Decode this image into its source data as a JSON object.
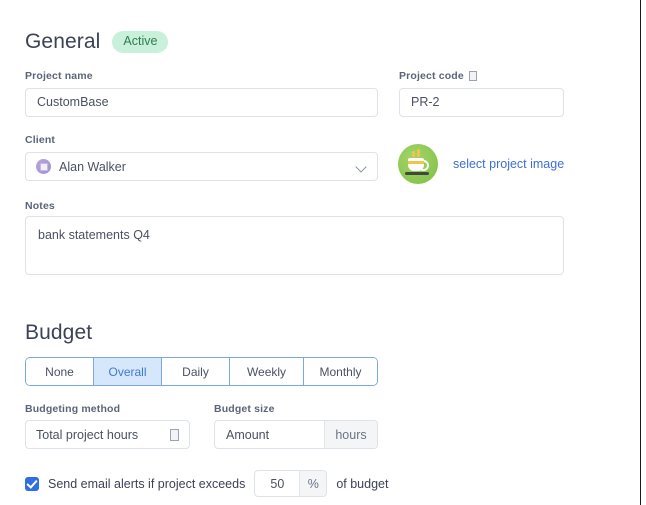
{
  "general": {
    "title": "General",
    "status_badge": "Active",
    "project_name": {
      "label": "Project name",
      "value": "CustomBase"
    },
    "project_code": {
      "label": "Project code",
      "info_icon": "info-icon",
      "value": "PR-2"
    },
    "client": {
      "label": "Client",
      "value": "Alan Walker",
      "avatar_icon": "client-avatar-icon",
      "chevron_icon": "chevron-down-icon"
    },
    "project_image": {
      "icon": "coffee-cup-icon",
      "link_label": "select project image"
    },
    "notes": {
      "label": "Notes",
      "value": "bank statements Q4"
    }
  },
  "budget": {
    "title": "Budget",
    "period_tabs": [
      {
        "label": "None",
        "selected": false
      },
      {
        "label": "Overall",
        "selected": true
      },
      {
        "label": "Daily",
        "selected": false
      },
      {
        "label": "Weekly",
        "selected": false
      },
      {
        "label": "Monthly",
        "selected": false
      }
    ],
    "budgeting_method": {
      "label": "Budgeting method",
      "value": "Total project hours",
      "dropdown_icon": "dropdown-icon"
    },
    "budget_size": {
      "label": "Budget size",
      "placeholder": "Amount",
      "unit": "hours"
    },
    "email_alert": {
      "checked": true,
      "text_before": "Send email alerts if project exceeds",
      "threshold_value": "50",
      "unit": "%",
      "text_after": "of budget"
    }
  },
  "colors": {
    "accent_blue": "#3d7ad6",
    "link_blue": "#3d6fd6",
    "badge_bg": "#c9f0da",
    "badge_text": "#2f7d52",
    "segment_selected_bg": "#d6e7fb",
    "checkbox_blue": "#2f6fe0",
    "project_image_green": "#7fc043"
  }
}
